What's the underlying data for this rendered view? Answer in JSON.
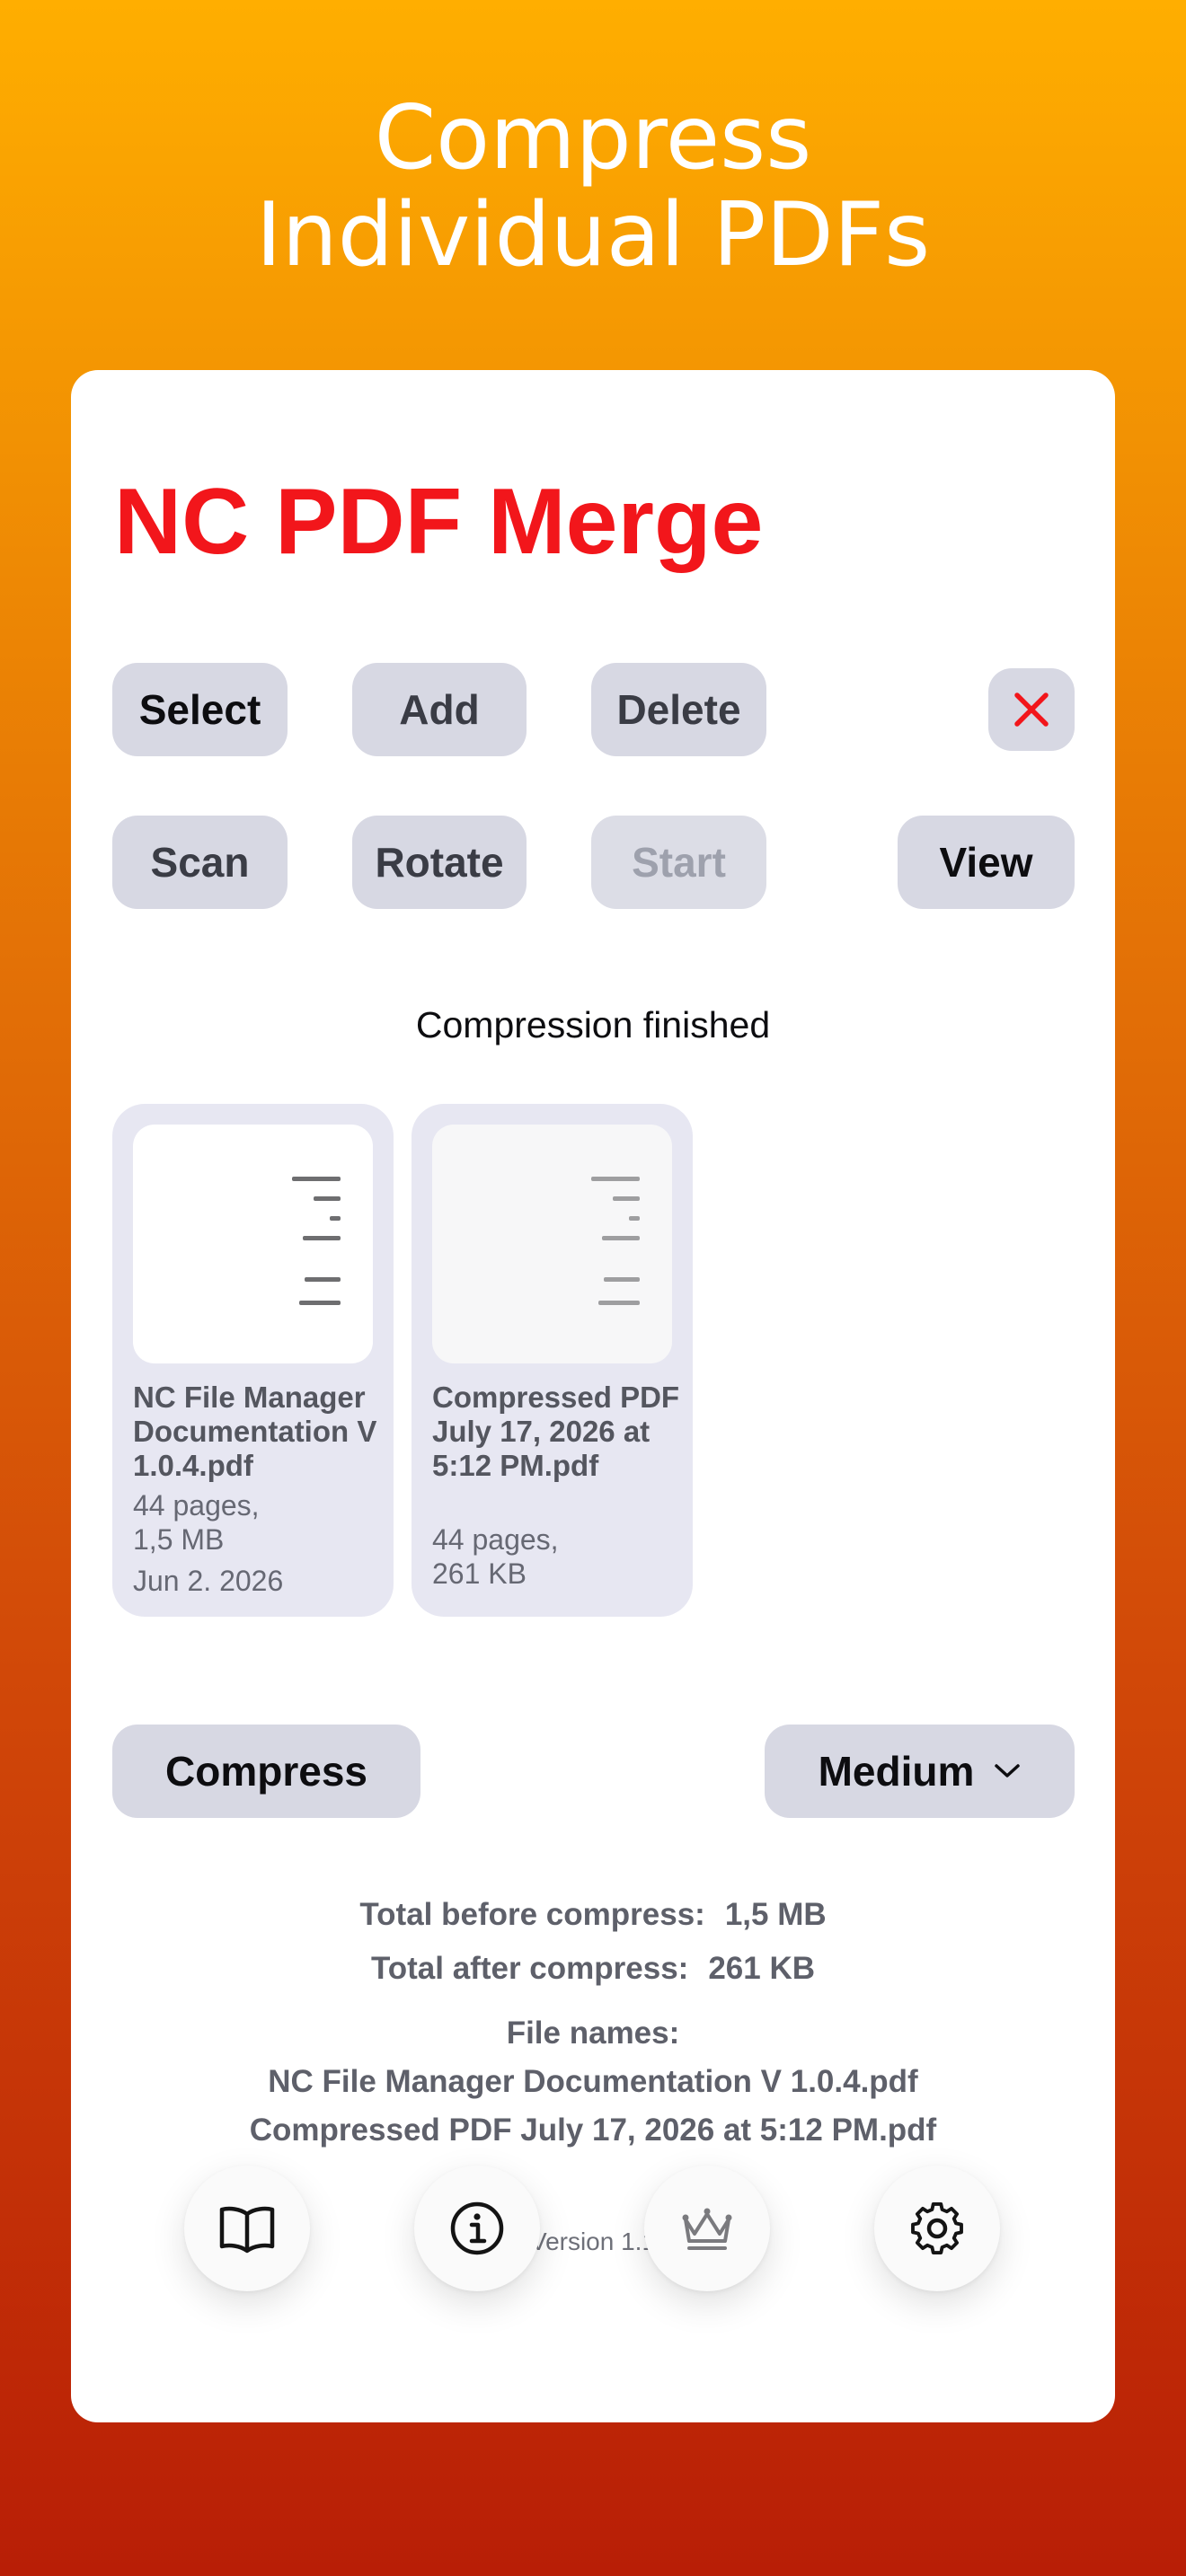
{
  "headline": {
    "line1": "Compress",
    "line2": "Individual PDFs"
  },
  "app": {
    "title": "NC PDF Merge"
  },
  "toolbar": {
    "select": "Select",
    "add": "Add",
    "delete": "Delete",
    "scan": "Scan",
    "rotate": "Rotate",
    "start": "Start",
    "view": "View"
  },
  "status": "Compression finished",
  "files": [
    {
      "name": "NC File Manager Documentation V 1.0.4.pdf",
      "pages": "44 pages,",
      "size": "1,5 MB",
      "date": "Jun 2. 2026"
    },
    {
      "name": "Compressed PDF July 17, 2026 at 5:12 PM.pdf",
      "pages": "44 pages,",
      "size": "261 KB"
    }
  ],
  "compress": {
    "button": "Compress",
    "level": "Medium"
  },
  "summary": {
    "before_label": "Total before compress:",
    "before_value": "1,5 MB",
    "after_label": "Total after compress:",
    "after_value": "261 KB",
    "file_names_label": "File names:",
    "file_names": [
      "NC File Manager Documentation V 1.0.4.pdf",
      "Compressed PDF July 17, 2026 at 5:12 PM.pdf"
    ]
  },
  "version": "Version 1.1",
  "bottom_nav": [
    {
      "icon": "book-icon"
    },
    {
      "icon": "info-icon"
    },
    {
      "icon": "crown-icon"
    },
    {
      "icon": "gear-icon"
    }
  ],
  "colors": {
    "accent_red": "#F2161B",
    "button_bg": "#D7D8E3",
    "tile_bg": "#E7E7F2"
  }
}
